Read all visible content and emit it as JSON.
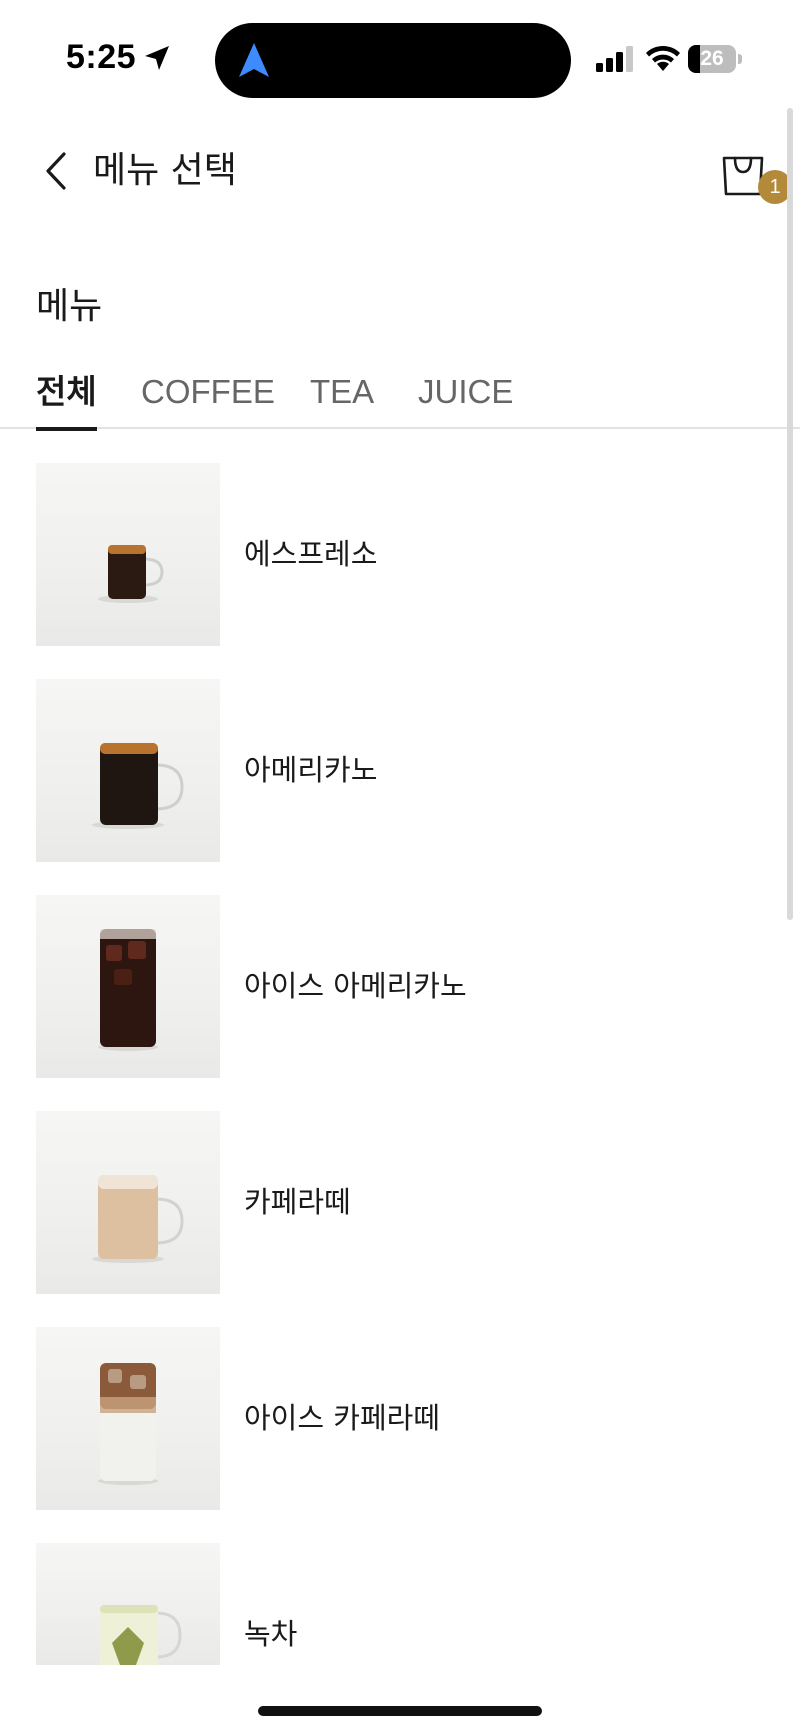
{
  "status_bar": {
    "time": "5:25",
    "battery": "26",
    "battery_level": 0.26
  },
  "header": {
    "title": "메뉴 선택",
    "cart_count": "1"
  },
  "colors": {
    "accent": "#b38a3a",
    "text": "#1a1a1a",
    "tab_inactive": "#666666",
    "nav_blue": "#3d8bff"
  },
  "menu": {
    "section_title": "메뉴",
    "tabs": [
      {
        "label": "전체",
        "active": true
      },
      {
        "label": "COFFEE",
        "active": false
      },
      {
        "label": "TEA",
        "active": false
      },
      {
        "label": "JUICE",
        "active": false
      }
    ],
    "items": [
      {
        "name": "에스프레소"
      },
      {
        "name": "아메리카노"
      },
      {
        "name": "아이스 아메리카노"
      },
      {
        "name": "카페라떼"
      },
      {
        "name": "아이스 카페라떼"
      },
      {
        "name": "녹차"
      }
    ]
  }
}
